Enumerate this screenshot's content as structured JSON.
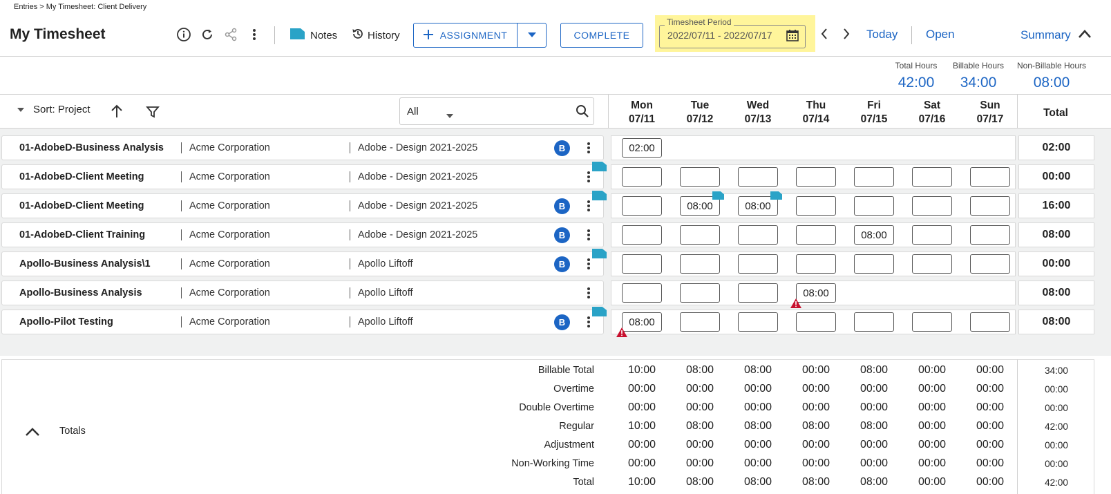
{
  "breadcrumb": "Entries > My Timesheet: Client Delivery",
  "page_title": "My Timesheet",
  "toolbar": {
    "notes_label": "Notes",
    "history_label": "History",
    "assignment_label": "ASSIGNMENT",
    "complete_label": "COMPLETE",
    "period_legend": "Timesheet Period",
    "period_value": "2022/07/11 - 2022/07/17",
    "today_label": "Today",
    "open_label": "Open",
    "summary_label": "Summary"
  },
  "hours_summary": {
    "total_label": "Total Hours",
    "total_value": "42:00",
    "billable_label": "Billable Hours",
    "billable_value": "34:00",
    "nonbillable_label": "Non-Billable Hours",
    "nonbillable_value": "08:00"
  },
  "sort": {
    "label": "Sort: Project",
    "filter_value": "All"
  },
  "days": [
    {
      "dow": "Mon",
      "date": "07/11"
    },
    {
      "dow": "Tue",
      "date": "07/12"
    },
    {
      "dow": "Wed",
      "date": "07/13"
    },
    {
      "dow": "Thu",
      "date": "07/14"
    },
    {
      "dow": "Fri",
      "date": "07/15"
    },
    {
      "dow": "Sat",
      "date": "07/16"
    },
    {
      "dow": "Sun",
      "date": "07/17"
    }
  ],
  "total_header": "Total",
  "rows": [
    {
      "task": "01-AdobeD-Business Analysis",
      "client": "Acme Corporation",
      "project": "Adobe - Design 2021-2025",
      "badge": "B",
      "total": "02:00"
    },
    {
      "task": "01-AdobeD-Client Meeting",
      "client": "Acme Corporation",
      "project": "Adobe - Design 2021-2025",
      "badge": "",
      "total": "00:00"
    },
    {
      "task": "01-AdobeD-Client Meeting",
      "client": "Acme Corporation",
      "project": "Adobe - Design 2021-2025",
      "badge": "B",
      "total": "16:00"
    },
    {
      "task": "01-AdobeD-Client Training",
      "client": "Acme Corporation",
      "project": "Adobe - Design 2021-2025",
      "badge": "B",
      "total": "08:00"
    },
    {
      "task": "Apollo-Business Analysis\\1",
      "client": "Acme Corporation",
      "project": "Apollo Liftoff",
      "badge": "B",
      "total": "00:00"
    },
    {
      "task": "Apollo-Business Analysis",
      "client": "Acme Corporation",
      "project": "Apollo Liftoff",
      "badge": "",
      "total": "08:00"
    },
    {
      "task": "Apollo-Pilot Testing",
      "client": "Acme Corporation",
      "project": "Apollo Liftoff",
      "badge": "B",
      "total": "08:00"
    }
  ],
  "cells": [
    [
      "02:00"
    ],
    [
      "",
      "",
      "",
      "",
      "",
      "",
      ""
    ],
    [
      "",
      "08:00",
      "08:00",
      "",
      "",
      "",
      ""
    ],
    [
      "",
      "",
      "",
      "",
      "08:00",
      "",
      ""
    ],
    [
      "",
      "",
      "",
      "",
      "",
      "",
      ""
    ],
    [
      "",
      "",
      "",
      "08:00"
    ],
    [
      "08:00",
      "",
      "",
      "",
      "",
      "",
      ""
    ]
  ],
  "totals": {
    "section_label": "Totals",
    "rows": [
      {
        "label": "Billable Total",
        "values": [
          "10:00",
          "08:00",
          "08:00",
          "00:00",
          "08:00",
          "00:00",
          "00:00"
        ],
        "total": "34:00"
      },
      {
        "label": "Overtime",
        "values": [
          "00:00",
          "00:00",
          "00:00",
          "00:00",
          "00:00",
          "00:00",
          "00:00"
        ],
        "total": "00:00"
      },
      {
        "label": "Double Overtime",
        "values": [
          "00:00",
          "00:00",
          "00:00",
          "00:00",
          "00:00",
          "00:00",
          "00:00"
        ],
        "total": "00:00"
      },
      {
        "label": "Regular",
        "values": [
          "10:00",
          "08:00",
          "08:00",
          "08:00",
          "08:00",
          "00:00",
          "00:00"
        ],
        "total": "42:00"
      },
      {
        "label": "Adjustment",
        "values": [
          "00:00",
          "00:00",
          "00:00",
          "00:00",
          "00:00",
          "00:00",
          "00:00"
        ],
        "total": "00:00"
      },
      {
        "label": "Non-Working Time",
        "values": [
          "00:00",
          "00:00",
          "00:00",
          "00:00",
          "00:00",
          "00:00",
          "00:00"
        ],
        "total": "00:00"
      },
      {
        "label": "Total",
        "values": [
          "10:00",
          "08:00",
          "08:00",
          "08:00",
          "08:00",
          "00:00",
          "00:00"
        ],
        "total": "42:00"
      }
    ]
  },
  "colors": {
    "accent": "#1c65c4",
    "note_flag": "#2aa3c7",
    "warning": "#c8102e",
    "highlight": "#fff59b"
  }
}
